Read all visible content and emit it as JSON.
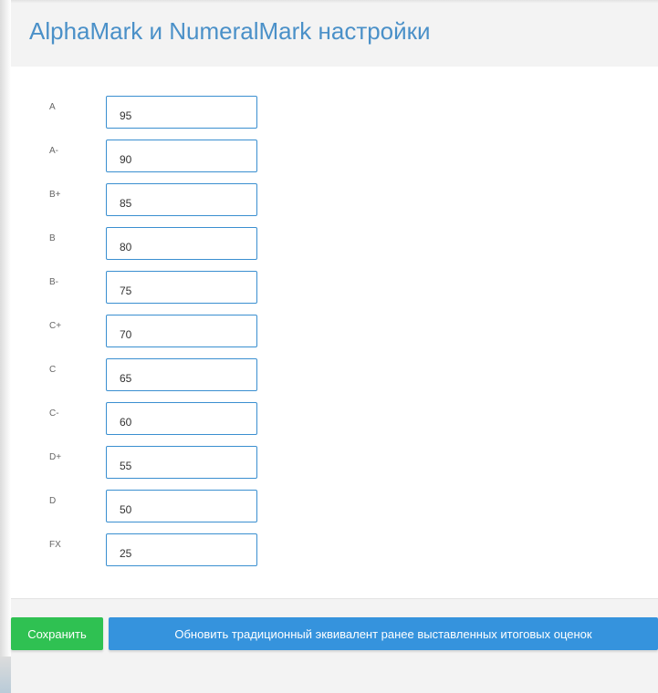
{
  "panel": {
    "title": "AlphaMark и NumeralMark настройки"
  },
  "grades": [
    {
      "label": "A",
      "value": "95"
    },
    {
      "label": "A-",
      "value": "90"
    },
    {
      "label": "B+",
      "value": "85"
    },
    {
      "label": "B",
      "value": "80"
    },
    {
      "label": "B-",
      "value": "75"
    },
    {
      "label": "C+",
      "value": "70"
    },
    {
      "label": "C",
      "value": "65"
    },
    {
      "label": "C-",
      "value": "60"
    },
    {
      "label": "D+",
      "value": "55"
    },
    {
      "label": "D",
      "value": "50"
    },
    {
      "label": "FX",
      "value": "25"
    }
  ],
  "footer": {
    "save_label": "Сохранить",
    "update_label": "Обновить традиционный эквивалент ранее выставленных итоговых оценок"
  },
  "colors": {
    "title": "#4a90c8",
    "save_button": "#2fc152",
    "update_button": "#3593dd",
    "input_border": "#3a8fd0"
  }
}
